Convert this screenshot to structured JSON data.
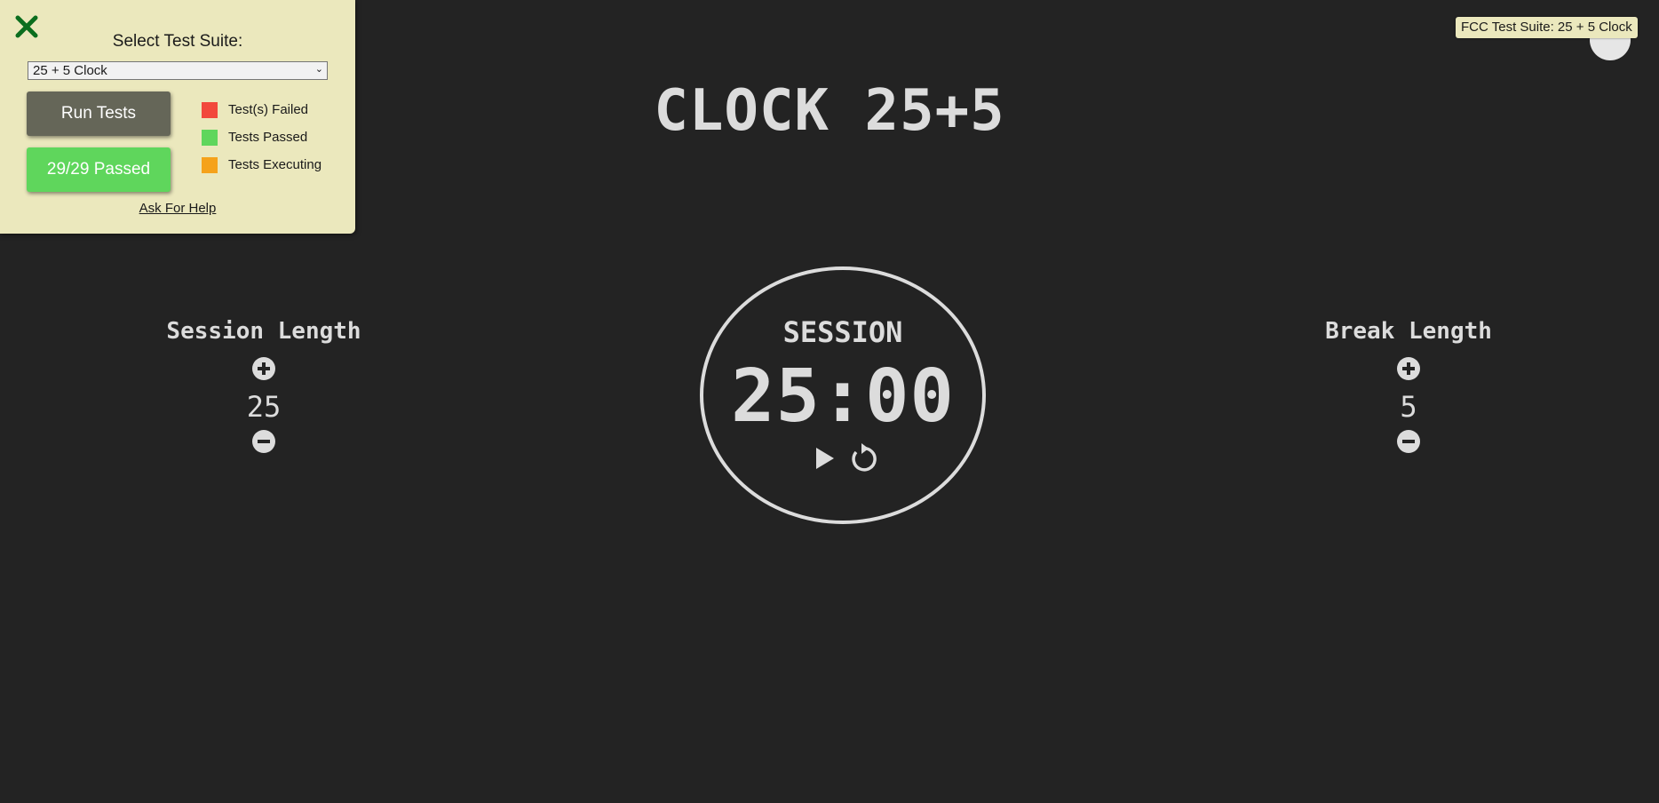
{
  "fcc_panel": {
    "close_icon": "close-x-icon",
    "suite_label": "Select Test Suite:",
    "suite_selected": "25 + 5 Clock",
    "run_tests_label": "Run Tests",
    "passed_label": "29/29 Passed",
    "legend": [
      {
        "label": "Test(s) Failed",
        "color": "#f2483c"
      },
      {
        "label": "Tests Passed",
        "color": "#5fd65c"
      },
      {
        "label": "Tests Executing",
        "color": "#f5a21b"
      }
    ],
    "help_label": "Ask For Help"
  },
  "tooltip": "FCC Test Suite: 25 + 5 Clock",
  "clock": {
    "title": "CLOCK 25+5",
    "session_length_label": "Session Length",
    "session_length": "25",
    "break_length_label": "Break Length",
    "break_length": "5",
    "timer_label": "SESSION",
    "time_left": "25:00"
  },
  "colors": {
    "background": "#232323",
    "text": "#dcdcdc",
    "panel": "#ebe8bd"
  },
  "icons": {
    "increment": "plus-circle-icon",
    "decrement": "minus-circle-icon",
    "start_stop": "play-icon",
    "reset": "reset-icon"
  }
}
